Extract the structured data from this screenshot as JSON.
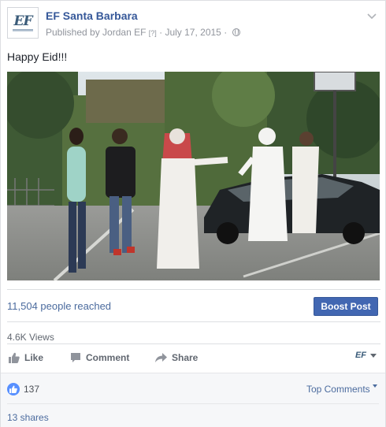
{
  "post": {
    "page_name": "EF Santa Barbara",
    "logo_text": "EF",
    "published_prefix": "Published by Jordan EF",
    "published_tag": "[?]",
    "date_sep": "·",
    "date": "July 17, 2015",
    "audience_icon": "globe-icon",
    "menu_icon": "chevron-down-icon",
    "text": "Happy Eid!!!"
  },
  "video": {
    "media_type": "video",
    "scene": "outdoor parking lot, people dancing"
  },
  "insights": {
    "reached": "11,504 people reached",
    "boost_label": "Boost Post",
    "views": "4.6K Views"
  },
  "actions": {
    "like": "Like",
    "comment": "Comment",
    "share": "Share",
    "page_selector": "EF"
  },
  "reactions": {
    "like_count": "137",
    "top_comments": "Top Comments",
    "shares": "13 shares"
  },
  "colors": {
    "link": "#365899",
    "boost_bg": "#4267b2",
    "like_badge": "#5890ff"
  }
}
